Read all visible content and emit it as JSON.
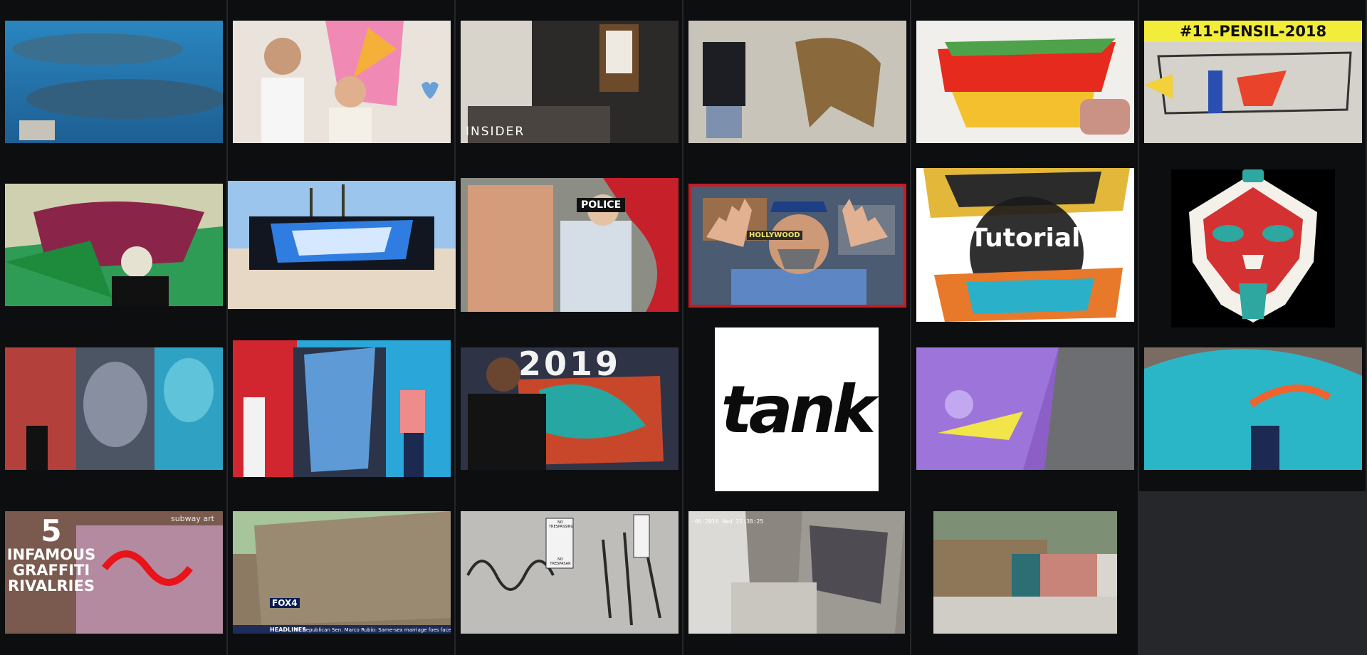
{
  "tiles": {
    "insider": {
      "label": "INSIDER"
    },
    "pensil": {
      "label": "#11-PENSIL-2018"
    },
    "police": {
      "label": "POLICE"
    },
    "hollywood": {
      "label": "HOLLYWOOD"
    },
    "tutorial": {
      "label": "Tutorial"
    },
    "year": {
      "label": "2019"
    },
    "tank": {
      "label": "tank"
    },
    "rivalries": {
      "line1": "5",
      "line2": "INFAMOUS",
      "line3": "GRAFFITI",
      "line4": "RIVALRIES",
      "corner": "subway art"
    },
    "news": {
      "station": "FOX4",
      "tag": "HEADLINES",
      "ticker": "FL Republican Sen. Marco Rubio: Same-sex marriage foes face 'intolerance'"
    },
    "notrespassing": {
      "sign1": "NO TRESPASSING",
      "sign2": "NO TRESPASAR"
    },
    "cctv": {
      "timestamp": "-06-2016 Wed 21:38:25"
    }
  }
}
